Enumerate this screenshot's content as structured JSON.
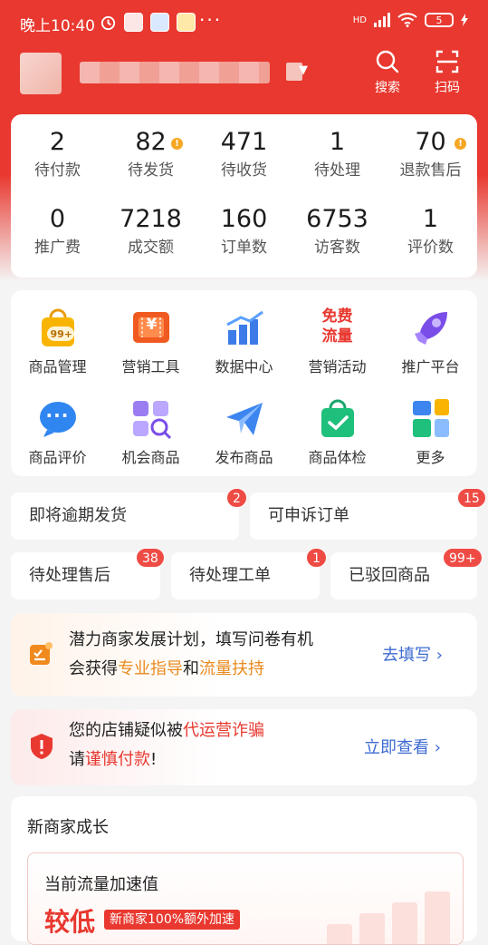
{
  "status_bar": {
    "time": "晚上10:40",
    "dots": "···",
    "network": "HD",
    "battery": "5"
  },
  "header": {
    "search_label": "搜索",
    "scan_label": "扫码"
  },
  "stats": [
    {
      "value": "2",
      "label": "待付款",
      "alert": false
    },
    {
      "value": "82",
      "label": "待发货",
      "alert": true
    },
    {
      "value": "471",
      "label": "待收货",
      "alert": false
    },
    {
      "value": "1",
      "label": "待处理",
      "alert": false
    },
    {
      "value": "70",
      "label": "退款售后",
      "alert": true
    },
    {
      "value": "0",
      "label": "推广费",
      "alert": false
    },
    {
      "value": "7218",
      "label": "成交额",
      "alert": false
    },
    {
      "value": "160",
      "label": "订单数",
      "alert": false
    },
    {
      "value": "6753",
      "label": "访客数",
      "alert": false
    },
    {
      "value": "1",
      "label": "评价数",
      "alert": false
    }
  ],
  "alert_mark": "!",
  "tools": [
    {
      "label": "商品管理",
      "icon": "shopping-bag-icon",
      "badge_text": "99+"
    },
    {
      "label": "营销工具",
      "icon": "coupon-icon",
      "badge_text": "¥"
    },
    {
      "label": "数据中心",
      "icon": "bar-chart-icon"
    },
    {
      "label": "营销活动",
      "icon": "free-traffic-icon",
      "badge_text": "免费流量"
    },
    {
      "label": "推广平台",
      "icon": "rocket-icon"
    },
    {
      "label": "商品评价",
      "icon": "chat-bubble-icon",
      "badge_text": "···"
    },
    {
      "label": "机会商品",
      "icon": "grid-search-icon"
    },
    {
      "label": "发布商品",
      "icon": "paper-plane-icon"
    },
    {
      "label": "商品体检",
      "icon": "check-bag-icon"
    },
    {
      "label": "更多",
      "icon": "more-apps-icon"
    }
  ],
  "tasks": [
    {
      "label": "即将逾期发货",
      "count": "2"
    },
    {
      "label": "可申诉订单",
      "count": "15"
    },
    {
      "label": "待处理售后",
      "count": "38"
    },
    {
      "label": "待处理工单",
      "count": "1"
    },
    {
      "label": "已驳回商品",
      "count": "99+"
    }
  ],
  "banner_plan": {
    "line1": "潜力商家发展计划，填写问卷有机",
    "line2_prefix": "会获得",
    "highlight1": "专业指导",
    "joiner": "和",
    "highlight2": "流量扶持",
    "link": "去填写"
  },
  "banner_fraud": {
    "line1_prefix": "您的店铺疑似被",
    "highlight1": "代运营诈骗",
    "line2_prefix": "请",
    "highlight2": "谨慎付款",
    "line2_suffix": "!",
    "link": "立即查看"
  },
  "growth": {
    "title": "新商家成长",
    "speed_title": "当前流量加速值",
    "speed_level": "较低",
    "speed_tag": "新商家100%额外加速"
  },
  "colors": {
    "brand_red": "#e8382f",
    "alert_orange": "#f5a623",
    "link_blue": "#3d6bd1"
  }
}
